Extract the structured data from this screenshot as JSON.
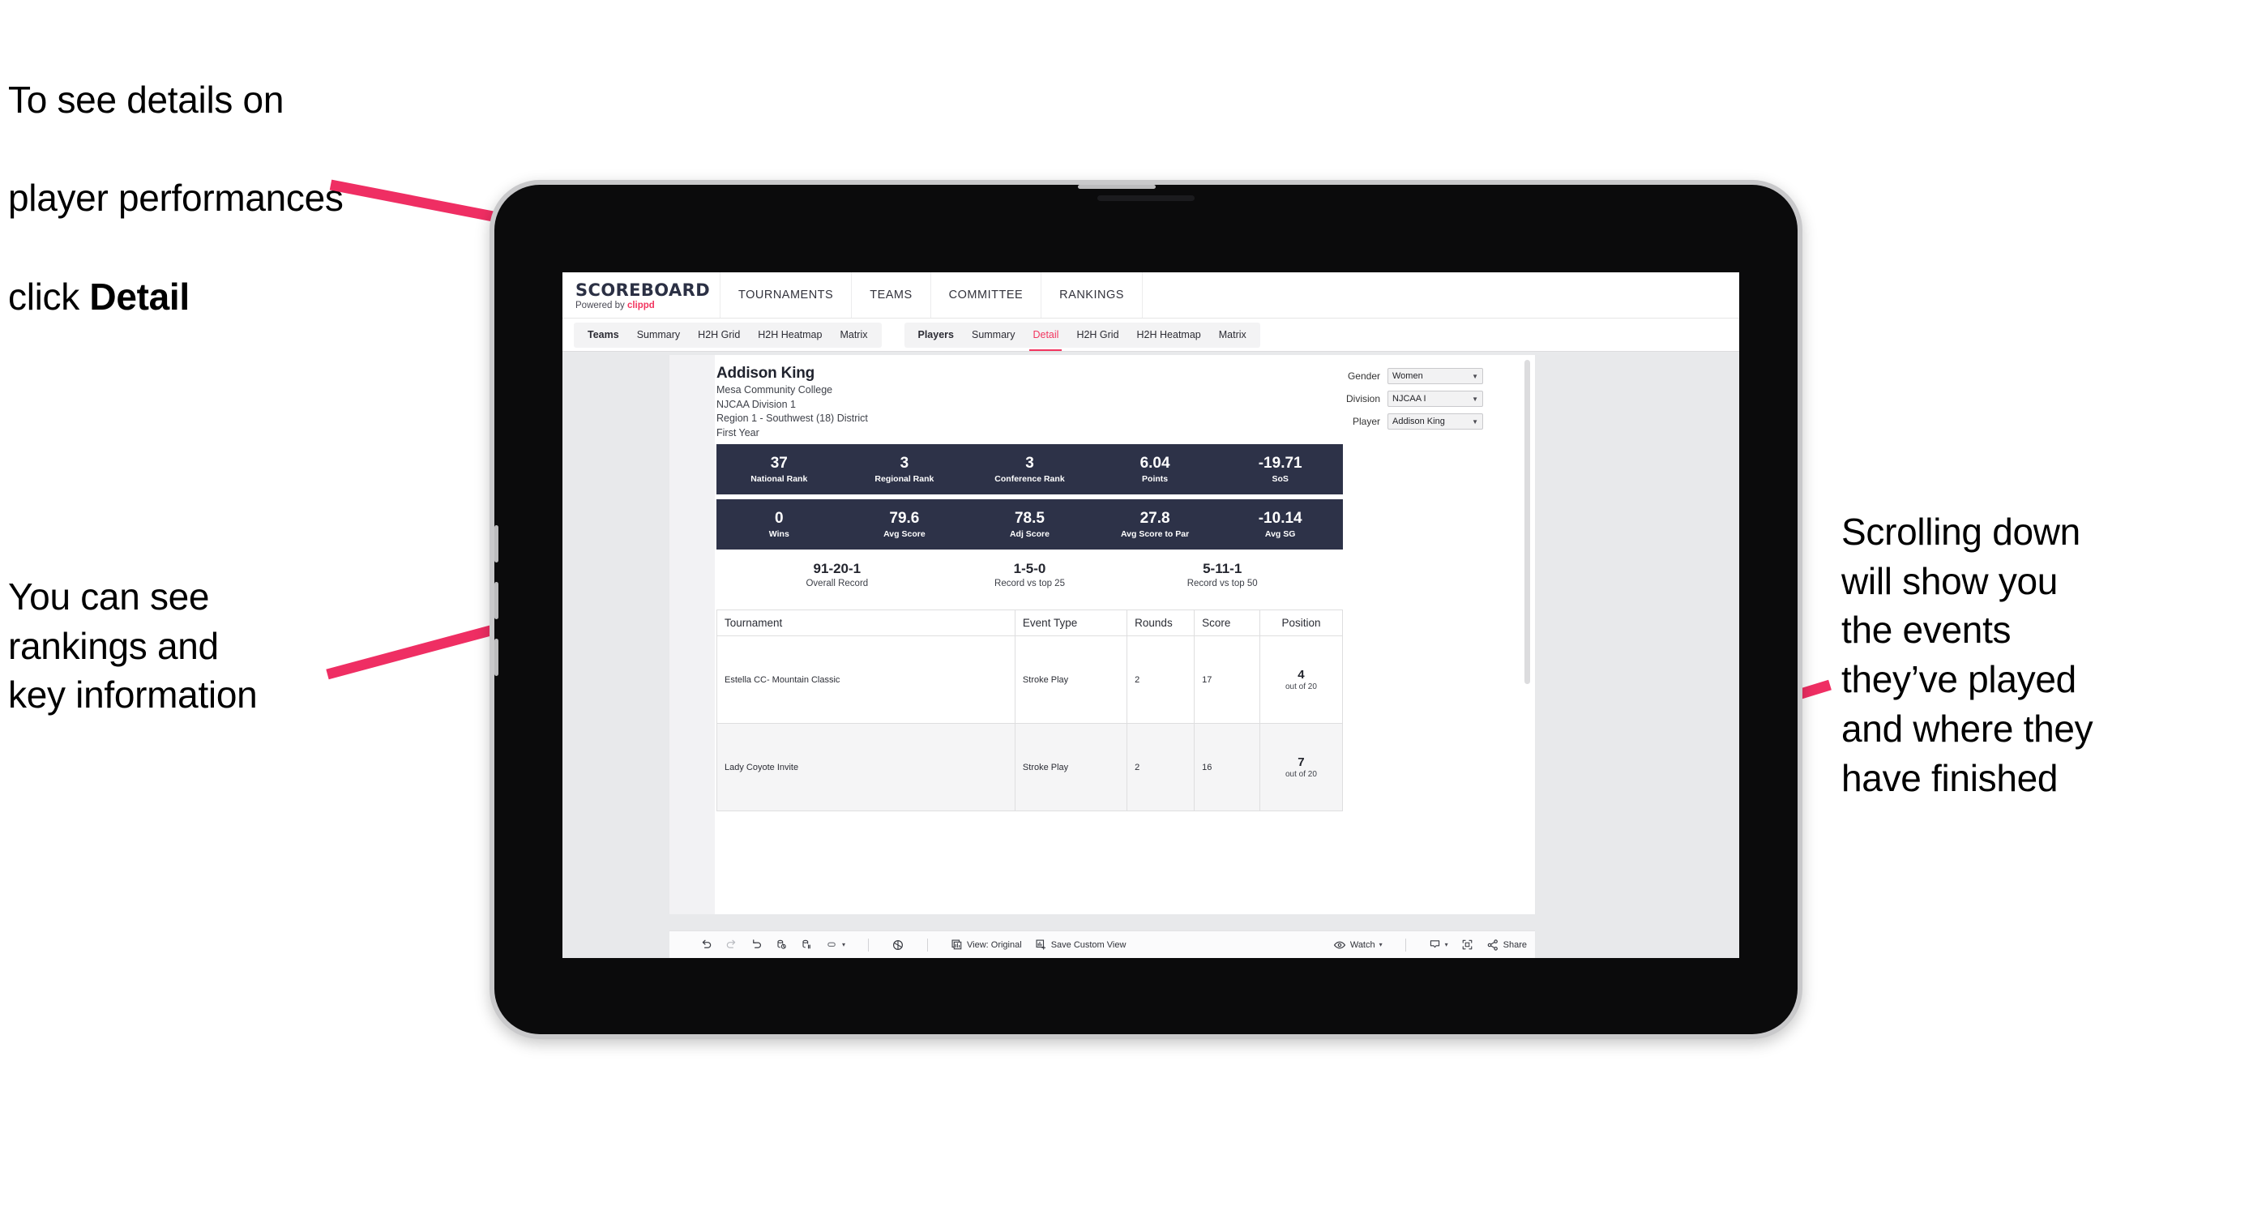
{
  "annotations": {
    "top_left": {
      "line1": "To see details on",
      "line2": "player performances",
      "line3_pre": "click ",
      "line3_bold": "Detail"
    },
    "mid_left": {
      "text": "You can see\nrankings and\nkey information"
    },
    "right": {
      "text": "Scrolling down\nwill show you\nthe events\nthey’ve played\nand where they\nhave finished"
    }
  },
  "colors": {
    "accent": "#f2355f",
    "panel_dark": "#2d3248",
    "page_bg": "#e8e9eb"
  },
  "app": {
    "brand": {
      "title": "SCOREBOARD",
      "sub_pre": "Powered by ",
      "sub_accent": "clippd"
    },
    "main_nav": [
      "TOURNAMENTS",
      "TEAMS",
      "COMMITTEE",
      "RANKINGS"
    ],
    "tab_group_teams": [
      "Teams",
      "Summary",
      "H2H Grid",
      "H2H Heatmap",
      "Matrix"
    ],
    "tab_group_players": [
      "Players",
      "Summary",
      "Detail",
      "H2H Grid",
      "H2H Heatmap",
      "Matrix"
    ],
    "active_tab": "Detail"
  },
  "player": {
    "name": "Addison King",
    "school": "Mesa Community College",
    "division": "NJCAA Division 1",
    "region": "Region 1 - Southwest (18) District",
    "year": "First Year"
  },
  "filters": [
    {
      "label": "Gender",
      "value": "Women"
    },
    {
      "label": "Division",
      "value": "NJCAA I"
    },
    {
      "label": "Player",
      "value": "Addison King"
    }
  ],
  "stats_band_1": [
    {
      "value": "37",
      "label": "National Rank"
    },
    {
      "value": "3",
      "label": "Regional Rank"
    },
    {
      "value": "3",
      "label": "Conference Rank"
    },
    {
      "value": "6.04",
      "label": "Points"
    },
    {
      "value": "-19.71",
      "label": "SoS"
    }
  ],
  "stats_band_2": [
    {
      "value": "0",
      "label": "Wins"
    },
    {
      "value": "79.6",
      "label": "Avg Score"
    },
    {
      "value": "78.5",
      "label": "Adj Score"
    },
    {
      "value": "27.8",
      "label": "Avg Score to Par"
    },
    {
      "value": "-10.14",
      "label": "Avg SG"
    }
  ],
  "records": [
    {
      "value": "91-20-1",
      "label": "Overall Record"
    },
    {
      "value": "1-5-0",
      "label": "Record vs top 25"
    },
    {
      "value": "5-11-1",
      "label": "Record vs top 50"
    }
  ],
  "tournaments": {
    "columns": [
      "Tournament",
      "Event Type",
      "Rounds",
      "Score",
      "Position"
    ],
    "rows": [
      {
        "tournament": "Estella CC- Mountain Classic",
        "event_type": "Stroke Play",
        "rounds": "2",
        "score": "17",
        "position": "4",
        "position_suffix": "out of 20"
      },
      {
        "tournament": "Lady Coyote Invite",
        "event_type": "Stroke Play",
        "rounds": "2",
        "score": "16",
        "position": "7",
        "position_suffix": "out of 20"
      }
    ]
  },
  "toolbar": {
    "view_label": "View: Original",
    "save_label": "Save Custom View",
    "watch_label": "Watch",
    "share_label": "Share"
  }
}
